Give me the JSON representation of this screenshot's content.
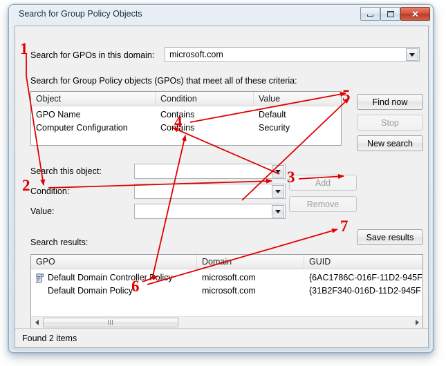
{
  "window": {
    "title": "Search for Group Policy Objects",
    "controls": {
      "minimize": "minimize",
      "maximize": "maximize",
      "close": "✕"
    }
  },
  "domain_section": {
    "label": "Search for GPOs in this domain:",
    "value": "microsoft.com"
  },
  "criteria_section": {
    "label": "Search for Group Policy objects (GPOs) that meet all of these criteria:",
    "columns": [
      "Object",
      "Condition",
      "Value"
    ],
    "rows": [
      {
        "object": "GPO Name",
        "condition": "Contains",
        "value": "Default"
      },
      {
        "object": "Computer Configuration",
        "condition": "Contains",
        "value": "Security"
      }
    ]
  },
  "action_buttons": {
    "find_now": "Find now",
    "stop": "Stop",
    "new_search": "New search"
  },
  "builder": {
    "object_label": "Search this object:",
    "object_value": "",
    "condition_label": "Condition:",
    "condition_value": "",
    "value_label": "Value:",
    "value_value": "",
    "add": "Add",
    "remove": "Remove"
  },
  "results_section": {
    "label": "Search results:",
    "save_button": "Save results",
    "columns": [
      "GPO",
      "Domain",
      "GUID"
    ],
    "rows": [
      {
        "gpo": "Default Domain Controller Policy",
        "domain": "microsoft.com",
        "guid": "{6AC1786C-016F-11D2-945F"
      },
      {
        "gpo": "Default Domain Policy",
        "domain": "microsoft.com",
        "guid": "{31B2F340-016D-11D2-945F"
      }
    ]
  },
  "statusbar": {
    "text": "Found 2 items"
  },
  "annotations": {
    "color": "#e00000",
    "markers": [
      {
        "id": "1",
        "label": "1"
      },
      {
        "id": "2",
        "label": "2"
      },
      {
        "id": "3",
        "label": "3"
      },
      {
        "id": "4",
        "label": "4"
      },
      {
        "id": "5",
        "label": "5"
      },
      {
        "id": "6",
        "label": "6"
      },
      {
        "id": "7",
        "label": "7"
      }
    ]
  }
}
